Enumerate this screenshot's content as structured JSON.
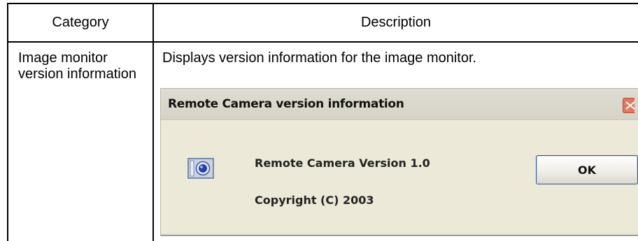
{
  "table": {
    "headers": {
      "category": "Category",
      "description": "Description"
    },
    "rows": [
      {
        "category": "Image monitor version information",
        "description": "Displays version information for the image monitor."
      }
    ]
  },
  "dialog": {
    "title": "Remote Camera version information",
    "version_text": "Remote Camera Version 1.0",
    "copyright_text": "Copyright (C) 2003",
    "ok_label": "OK",
    "icons": {
      "app": "camera-icon",
      "close": "close-icon"
    },
    "colors": {
      "face": "#ece9d8",
      "close_button": "#e0785f",
      "ok_border": "#3c5a8a"
    }
  }
}
